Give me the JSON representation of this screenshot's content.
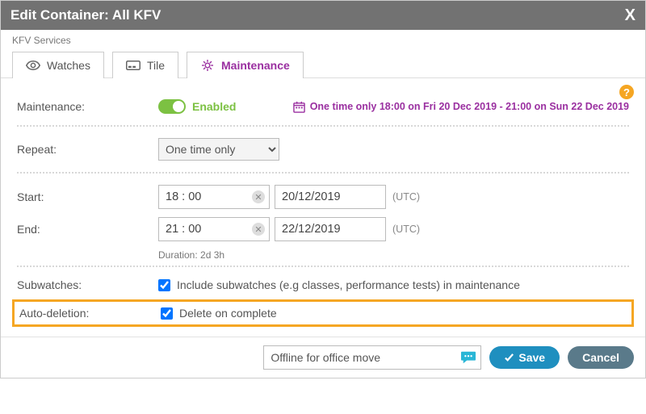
{
  "title": "Edit Container: All KFV",
  "breadcrumb": "KFV Services",
  "tabs": {
    "watches": "Watches",
    "tile": "Tile",
    "maintenance": "Maintenance"
  },
  "labels": {
    "maintenance": "Maintenance:",
    "repeat": "Repeat:",
    "start": "Start:",
    "end": "End:",
    "subwatches": "Subwatches:",
    "autodeletion": "Auto-deletion:"
  },
  "toggle": {
    "state": "Enabled"
  },
  "summary": "One time only 18:00 on Fri 20 Dec 2019 - 21:00 on Sun 22 Dec 2019",
  "repeat": {
    "selected": "One time only"
  },
  "start": {
    "time": "18 : 00",
    "date": "20/12/2019",
    "tz": "(UTC)"
  },
  "end": {
    "time": "21 : 00",
    "date": "22/12/2019",
    "tz": "(UTC)"
  },
  "duration": "Duration: 2d 3h",
  "subwatches_text": "Include subwatches (e.g classes, performance tests) in maintenance",
  "autodeletion_text": "Delete on complete",
  "comment": "Offline for office move",
  "buttons": {
    "save": "Save",
    "cancel": "Cancel"
  },
  "help_char": "?"
}
